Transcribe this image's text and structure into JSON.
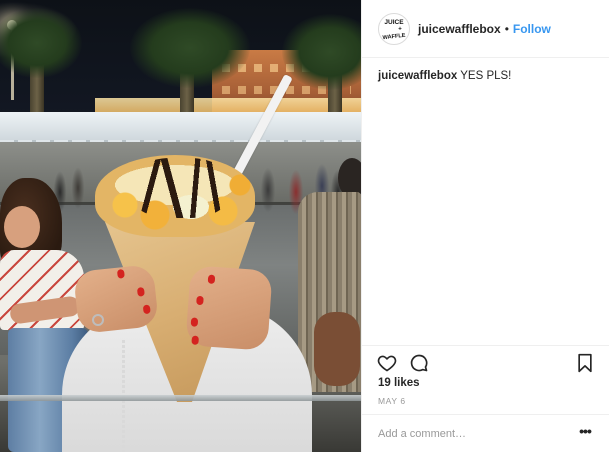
{
  "post": {
    "username": "juicewafflebox",
    "separator": "•",
    "follow_label": "Follow",
    "avatar_logo": [
      "JUICE",
      "+",
      "WAFFLE"
    ],
    "caption_user": "juicewafflebox",
    "caption_text": " YES PLS!",
    "likes": "19 likes",
    "date": "MAY 6",
    "comment_placeholder": "Add a comment…",
    "more_label": "•••"
  },
  "icons": [
    "heart-icon",
    "comment-icon",
    "bookmark-icon",
    "more-options-icon"
  ],
  "colors": {
    "follow_blue": "#3897f0",
    "text_dark": "#262626",
    "text_muted": "#999999",
    "divider": "#efefef",
    "nail_polish": "#d4231f"
  }
}
